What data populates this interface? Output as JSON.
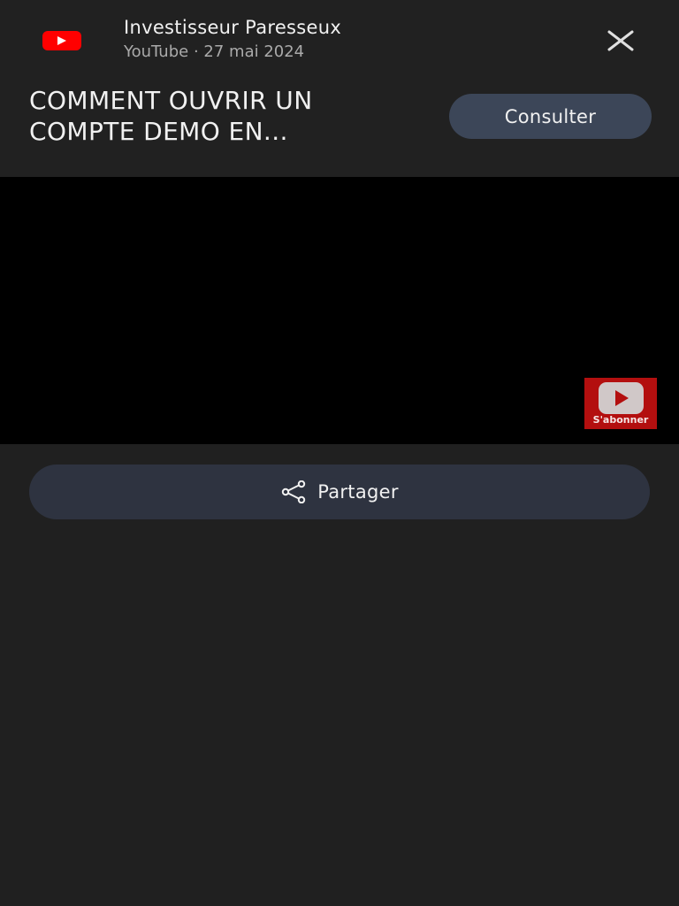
{
  "header": {
    "channel_name": "Investisseur Paresseux",
    "source": "YouTube",
    "separator": "·",
    "date": "27 mai 2024",
    "video_title": "COMMENT OUVRIR UN\nCOMPTE DEMO EN...",
    "consult_label": "Consulter"
  },
  "video": {
    "subscribe_label": "S'abonner"
  },
  "share": {
    "label": "Partager"
  },
  "icons": {
    "logo": "youtube-logo-icon",
    "close": "close-icon",
    "share": "share-icon",
    "subscribe": "youtube-play-icon"
  },
  "colors": {
    "background": "#202020",
    "youtube_red": "#ff0000",
    "consult_button": "#3c4658",
    "share_button": "#2e3340",
    "subscribe_badge": "#b30f0f"
  }
}
